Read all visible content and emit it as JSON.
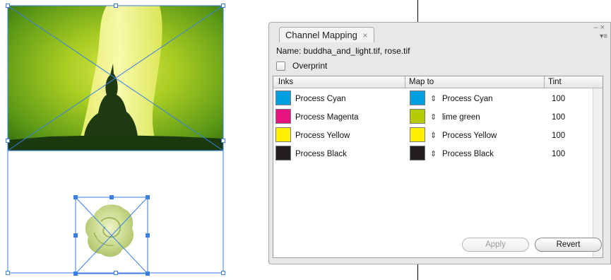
{
  "panel": {
    "tab_title": "Channel Mapping",
    "close_glyph": "×",
    "minimize_glyph": "– ×",
    "menu_glyph": "▾≡",
    "name_line": "Name: buddha_and_light.tif, rose.tif",
    "overprint_label": "Overprint",
    "overprint_checked": false
  },
  "table": {
    "headers": {
      "inks": "Inks",
      "map_to": "Map to",
      "tint": "Tint"
    },
    "rows": [
      {
        "ink": "Process Cyan",
        "ink_color": "#00a0e0",
        "map_to": "Process Cyan",
        "map_color": "#00a0e0",
        "tint": "100"
      },
      {
        "ink": "Process Magenta",
        "ink_color": "#e6127d",
        "map_to": "lime green",
        "map_color": "#b5cc00",
        "tint": "100"
      },
      {
        "ink": "Process Yellow",
        "ink_color": "#fff000",
        "map_to": "Process Yellow",
        "map_color": "#fff000",
        "tint": "100"
      },
      {
        "ink": "Process Black",
        "ink_color": "#231f20",
        "map_to": "Process Black",
        "map_color": "#231f20",
        "tint": "100"
      }
    ],
    "map_arrow_glyph": "⇕"
  },
  "buttons": {
    "apply": "Apply",
    "revert": "Revert"
  },
  "colors": {
    "selection_blue": "#3a7fe0",
    "photo_green_dark": "#1e5a10",
    "photo_green_light": "#a8d020",
    "light_glow": "#f6f59a",
    "rose": "#c7d98a"
  }
}
